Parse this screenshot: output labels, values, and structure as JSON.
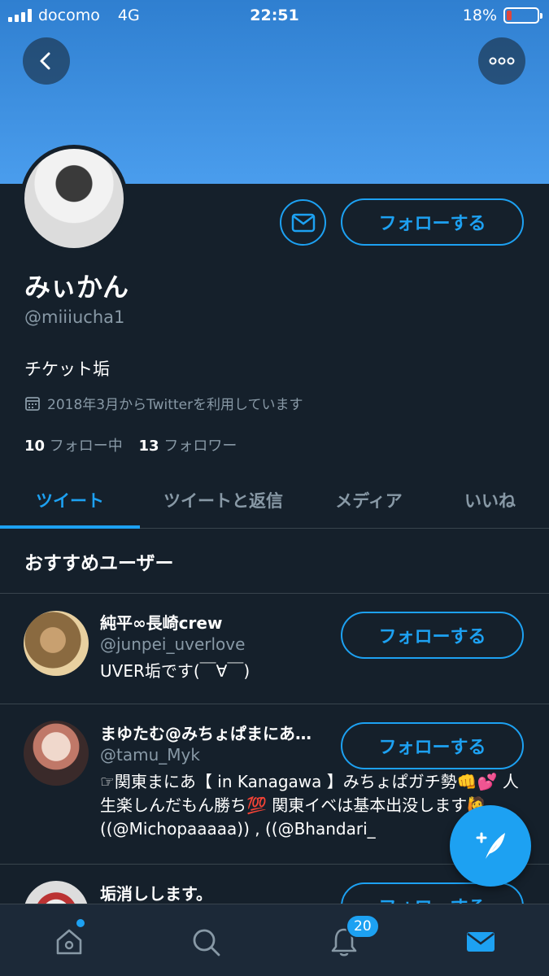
{
  "status": {
    "carrier": "docomo",
    "network": "4G",
    "time": "22:51",
    "battery": "18%",
    "battery_level": 0.18,
    "battery_color": "#e0463c"
  },
  "profile": {
    "name": "みぃかん",
    "handle": "@miiiucha1",
    "bio": "チケット垢",
    "joined": "2018年3月からTwitterを利用しています",
    "following_count": "10",
    "following_label": "フォロー中",
    "followers_count": "13",
    "followers_label": "フォロワー",
    "follow_label": "フォローする"
  },
  "tabs": [
    {
      "label": "ツイート",
      "active": true
    },
    {
      "label": "ツイートと返信",
      "active": false
    },
    {
      "label": "メディア",
      "active": false
    },
    {
      "label": "いいね",
      "active": false
    }
  ],
  "recommendations": {
    "title": "おすすめユーザー",
    "users": [
      {
        "name": "純平∞長崎crew",
        "handle": "@junpei_uverlove",
        "desc": "UVER垢です(￣∀￣)",
        "follow_label": "フォローする"
      },
      {
        "name": "まゆたむ@みちょぱまにあ…",
        "handle": "@tamu_Myk",
        "desc": "☞関東まにあ【 in Kanagawa 】みちょぱガチ勢👊💕 人生楽しんだもん勝ち💯 関東イベは基本出没します🙋 ((@Michopaaaaa)) , ((@Bhandari_",
        "follow_label": "フォローする"
      },
      {
        "name": "垢消しします。",
        "handle": "",
        "desc": "",
        "follow_label": "フォローする"
      }
    ]
  },
  "nav": {
    "notifications_badge": "20"
  },
  "colors": {
    "accent": "#1da1f2",
    "background": "#15202b",
    "muted": "#8899a6"
  }
}
